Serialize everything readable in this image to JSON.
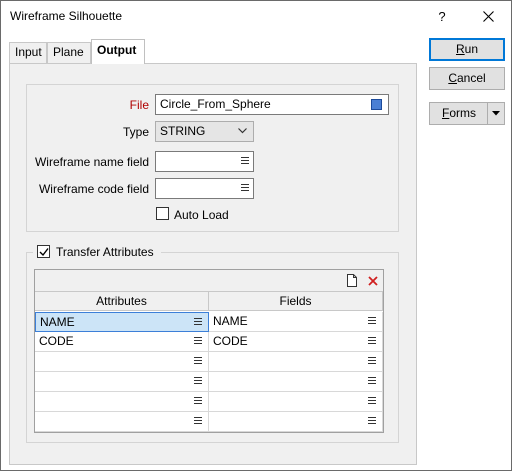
{
  "window": {
    "title": "Wireframe Silhouette",
    "help": "?"
  },
  "tabs": [
    {
      "label": "Input"
    },
    {
      "label": "Plane"
    },
    {
      "label": "Output"
    }
  ],
  "form": {
    "file_label": "File",
    "file_value": "Circle_From_Sphere",
    "type_label": "Type",
    "type_value": "STRING",
    "wf_name_label": "Wireframe name field",
    "wf_name_value": "",
    "wf_code_label": "Wireframe code field",
    "wf_code_value": "",
    "auto_load_label": "Auto Load",
    "auto_load_checked": false
  },
  "transfer": {
    "label": "Transfer Attributes",
    "checked": true,
    "columns": [
      "Attributes",
      "Fields"
    ],
    "rows": [
      {
        "attribute": "NAME",
        "field": "NAME"
      },
      {
        "attribute": "CODE",
        "field": "CODE"
      },
      {
        "attribute": "",
        "field": ""
      },
      {
        "attribute": "",
        "field": ""
      },
      {
        "attribute": "",
        "field": ""
      },
      {
        "attribute": "",
        "field": ""
      }
    ]
  },
  "buttons": {
    "run": {
      "prefix": "",
      "mnemonic": "R",
      "rest": "un"
    },
    "cancel": {
      "prefix": "",
      "mnemonic": "C",
      "rest": "ancel"
    },
    "forms": {
      "prefix": "",
      "mnemonic": "F",
      "rest": "orms"
    }
  },
  "colors": {
    "required_label": "#b00000",
    "primary_border": "#0078d7",
    "selection": "#cce4f7"
  }
}
